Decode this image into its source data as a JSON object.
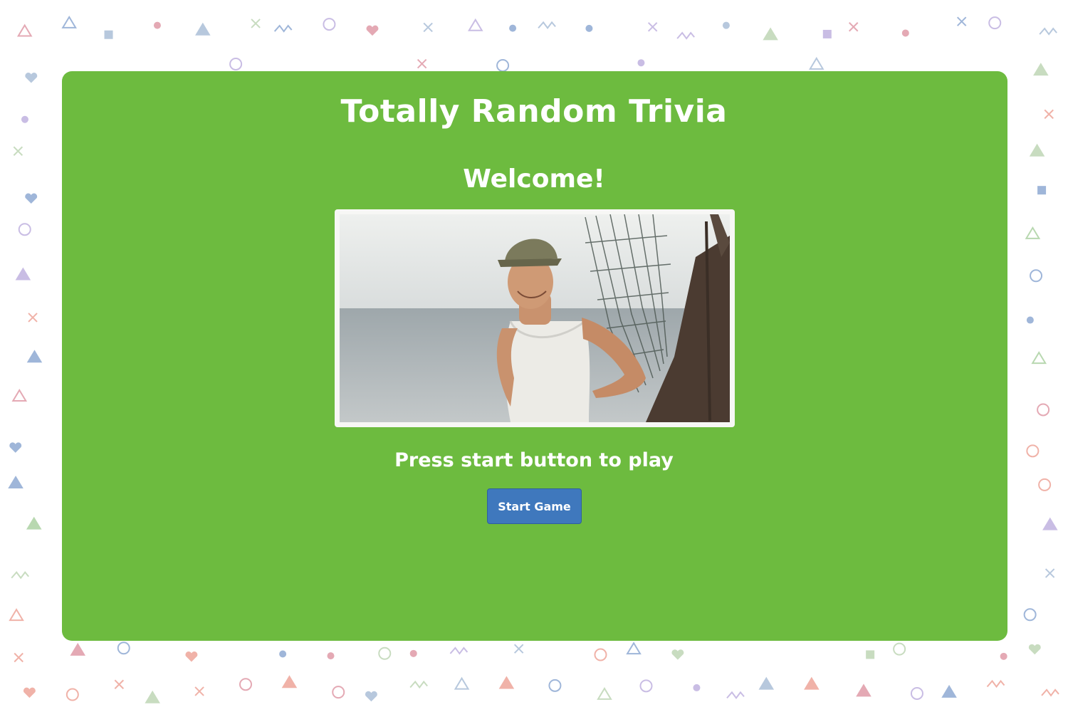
{
  "app": {
    "title": "Totally Random Trivia",
    "welcome": "Welcome!",
    "prompt": "Press start button to play",
    "start_button_label": "Start Game"
  },
  "colors": {
    "card_background": "#6dbb3f",
    "button_background": "#3f78bd",
    "text": "#ffffff"
  },
  "image": {
    "subject": "smiling man in a cap and white tank top on a fishing boat by the sea"
  },
  "background_pattern": {
    "shapes": [
      "circle",
      "triangle",
      "heart",
      "cross",
      "squiggle",
      "square",
      "dot"
    ]
  }
}
